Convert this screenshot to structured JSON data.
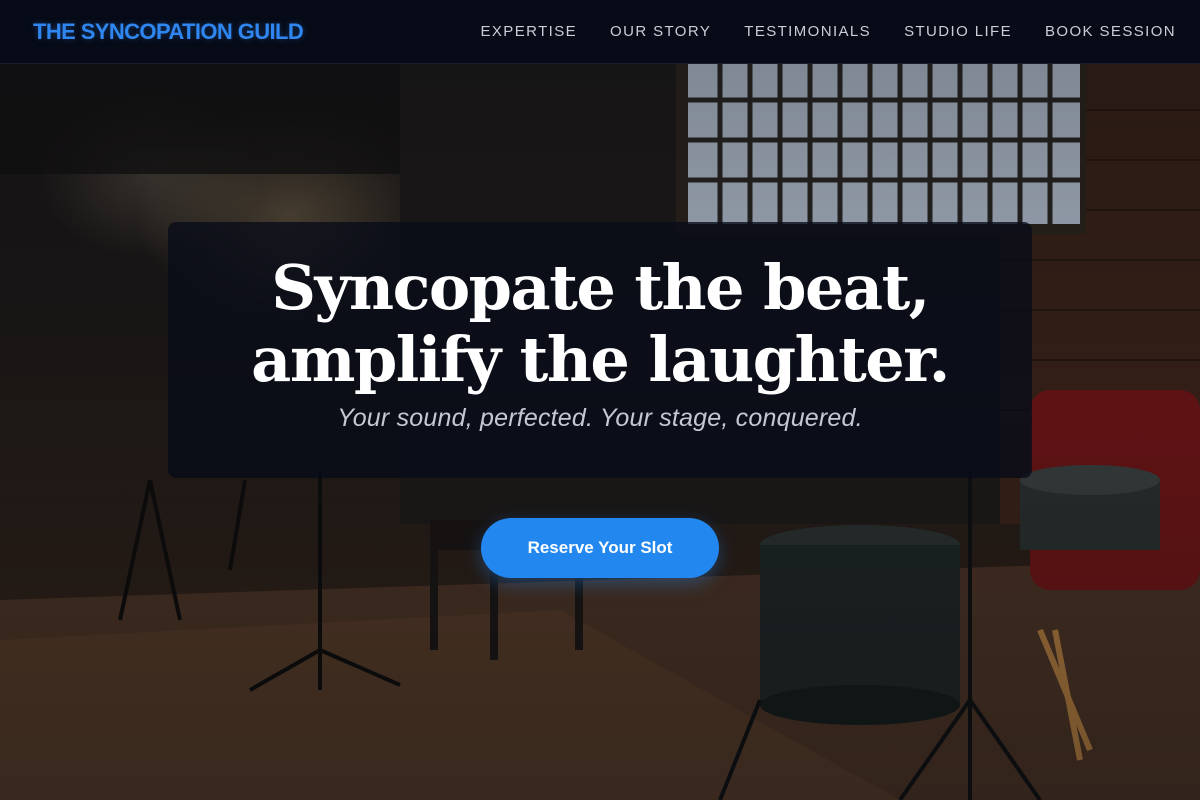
{
  "brand": {
    "name": "THE SYNCOPATION GUILD",
    "color": "#2f86f0"
  },
  "nav": {
    "items": [
      {
        "label": "EXPERTISE"
      },
      {
        "label": "OUR STORY"
      },
      {
        "label": "TESTIMONIALS"
      },
      {
        "label": "STUDIO LIFE"
      },
      {
        "label": "BOOK SESSION"
      }
    ]
  },
  "hero": {
    "title_line1": "Syncopate the beat,",
    "title_line2": "amplify the laughter.",
    "subtitle": "Your sound, perfected. Your stage, conquered.",
    "cta_label": "Reserve Your Slot",
    "cta_color": "#2288f0",
    "background_image": "dark-studio-with-drum-kit-and-window"
  }
}
